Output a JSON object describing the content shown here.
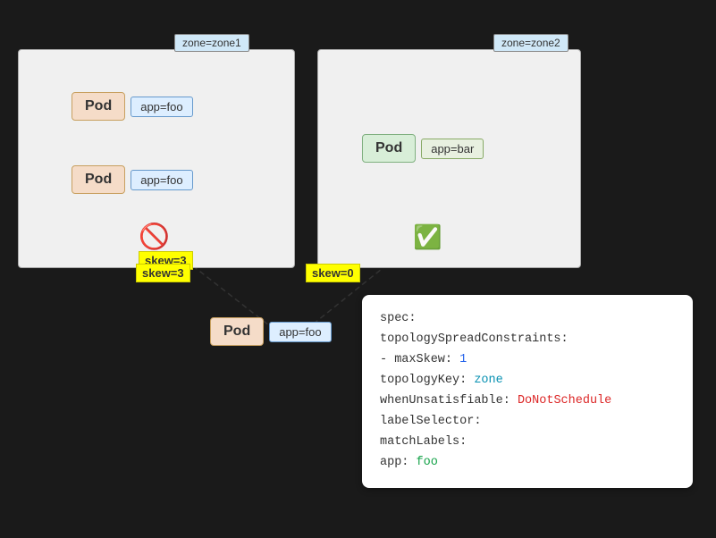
{
  "zone1": {
    "label": "zone=zone1",
    "pod1": {
      "label": "Pod",
      "tag": "app=foo"
    },
    "pod2": {
      "label": "Pod",
      "tag": "app=foo"
    },
    "skew": "skew=3"
  },
  "zone2": {
    "label": "zone=zone2",
    "pod1": {
      "label": "Pod",
      "tag": "app=bar"
    },
    "skew": "skew=0"
  },
  "newPod": {
    "label": "Pod",
    "tag": "app=foo"
  },
  "code": {
    "line1": "spec:",
    "line2": "  topologySpreadConstraints:",
    "line3": "  - maxSkew: 1",
    "line4": "    topologyKey: zone",
    "line5": "    whenUnsatisfiable: DoNotSchedule",
    "line6": "    labelSelector:",
    "line7": "      matchLabels:",
    "line8": "        app: foo"
  }
}
